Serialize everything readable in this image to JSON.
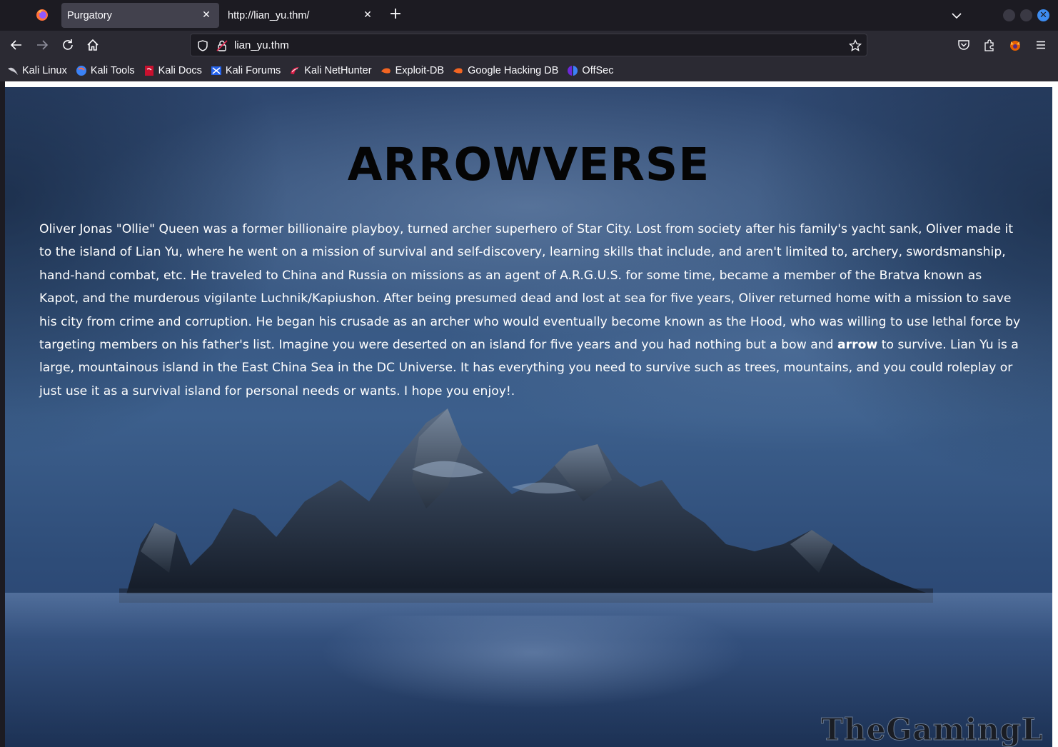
{
  "browser": {
    "tabs": [
      {
        "label": "Purgatory",
        "active": true
      },
      {
        "label": "http://lian_yu.thm/",
        "active": false
      }
    ],
    "url": "lian_yu.thm",
    "new_tab_symbol": "+",
    "close_symbol": "✕",
    "bookmarks": [
      {
        "label": "Kali Linux",
        "icon": "kali-dragon-icon"
      },
      {
        "label": "Kali Tools",
        "icon": "kali-tools-icon"
      },
      {
        "label": "Kali Docs",
        "icon": "kali-docs-icon"
      },
      {
        "label": "Kali Forums",
        "icon": "kali-forums-icon"
      },
      {
        "label": "Kali NetHunter",
        "icon": "nethunter-icon"
      },
      {
        "label": "Exploit-DB",
        "icon": "exploit-db-icon"
      },
      {
        "label": "Google Hacking DB",
        "icon": "ghdb-icon"
      },
      {
        "label": "OffSec",
        "icon": "offsec-icon"
      }
    ],
    "accent_color": "#3d8cf0"
  },
  "page": {
    "title": "ARROWVERSE",
    "text_before": "Oliver Jonas \"Ollie\" Queen was a former billionaire playboy, turned archer superhero of Star City. Lost from society after his family's yacht sank, Oliver made it to the island of Lian Yu, where he went on a mission of survival and self-discovery, learning skills that include, and aren't limited to, archery, swordsmanship, hand-hand combat, etc. He traveled to China and Russia on missions as an agent of A.R.G.U.S. for some time, became a member of the Bratva known as Kapot, and the murderous vigilante Luchnik/Kapiushon. After being presumed dead and lost at sea for five years, Oliver returned home with a mission to save his city from crime and corruption. He began his crusade as an archer who would eventually become known as the Hood, who was willing to use lethal force by targeting members on his father's list. Imagine you were deserted on an island for five years and you had nothing but a bow and ",
    "text_bold": "arrow",
    "text_after": " to survive. Lian Yu is a large, mountainous island in the East China Sea in the DC Universe. It has everything you need to survive such as trees, mountains, and you could roleplay or just use it as a survival island for personal needs or wants. I hope you enjoy!.",
    "watermark": "TheGamingL"
  }
}
